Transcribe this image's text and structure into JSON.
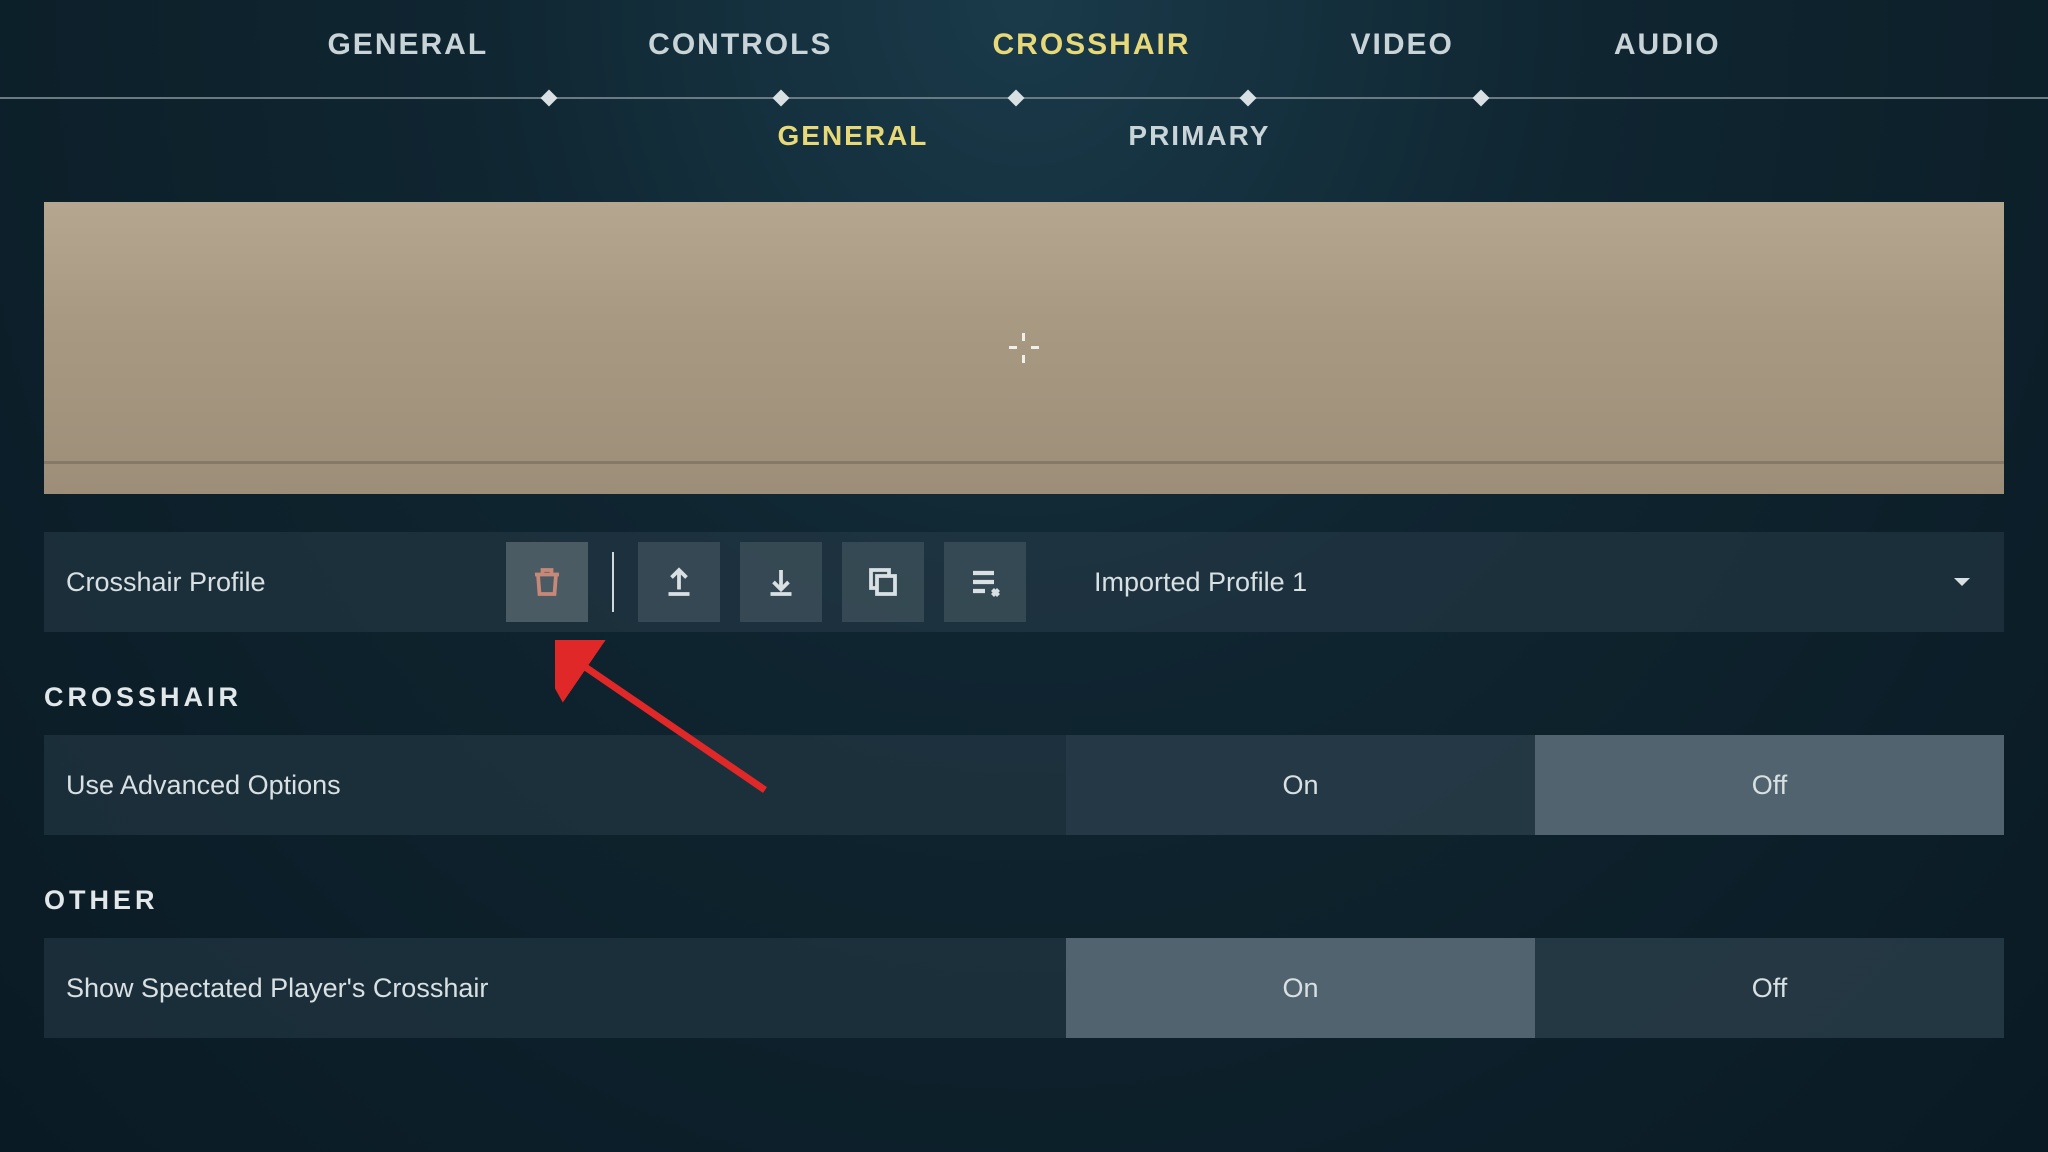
{
  "topTabs": {
    "general": "GENERAL",
    "controls": "CONTROLS",
    "crosshair": "CROSSHAIR",
    "video": "VIDEO",
    "audio": "AUDIO"
  },
  "subTabs": {
    "general": "GENERAL",
    "primary": "PRIMARY"
  },
  "profile": {
    "label": "Crosshair Profile",
    "selected": "Imported Profile 1"
  },
  "sections": {
    "crosshair": {
      "title": "CROSSHAIR",
      "advanced": {
        "label": "Use Advanced Options",
        "on": "On",
        "off": "Off",
        "value": "Off"
      }
    },
    "other": {
      "title": "OTHER",
      "spectated": {
        "label": "Show Spectated Player's Crosshair",
        "on": "On",
        "off": "Off",
        "value": "On"
      }
    }
  }
}
